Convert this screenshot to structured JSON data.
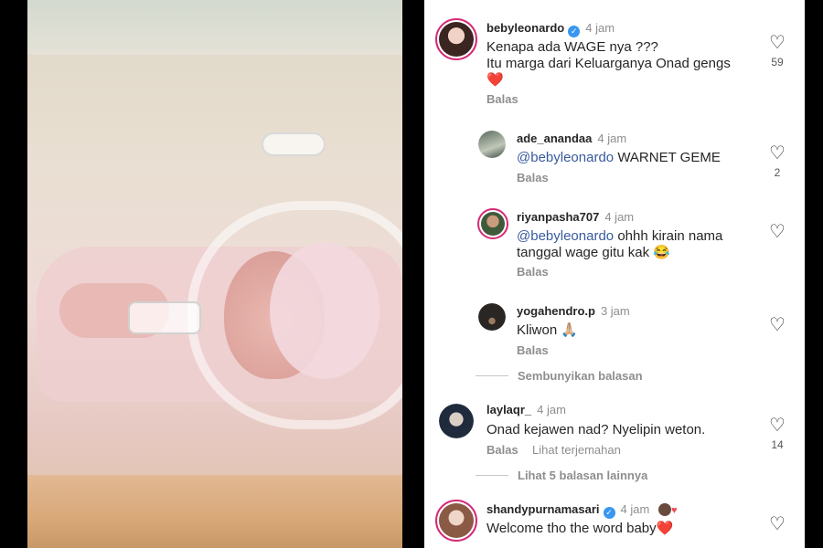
{
  "comments": [
    {
      "username": "bebyleonardo",
      "verified": true,
      "time": "4 jam",
      "text_line1": "Kenapa ada WAGE nya ???",
      "text_line2": "Itu marga dari Keluarganya Onad gengs",
      "emoji": "❤️",
      "reply_label": "Balas",
      "likes": "59"
    }
  ],
  "replies": [
    {
      "username": "ade_anandaa",
      "time": "4 jam",
      "mention": "@bebyleonardo",
      "text": "WARNET GEME",
      "reply_label": "Balas",
      "likes": "2"
    },
    {
      "username": "riyanpasha707",
      "time": "4 jam",
      "mention": "@bebyleonardo",
      "text": "ohhh kirain nama",
      "text_line2": "tanggal wage gitu kak 😂",
      "reply_label": "Balas"
    },
    {
      "username": "yogahendro.p",
      "time": "3 jam",
      "text": "Kliwon 🙏🏼",
      "reply_label": "Balas"
    }
  ],
  "hide_replies": "Sembunyikan balasan",
  "second_comment": {
    "username": "laylaqr_",
    "time": "4 jam",
    "text": "Onad kejawen nad? Nyelipin weton.",
    "reply_label": "Balas",
    "translate_label": "Lihat terjemahan",
    "likes": "14",
    "more_replies": "Lihat 5 balasan lainnya"
  },
  "third_comment": {
    "username": "shandypurnamasari",
    "verified": true,
    "time": "4 jam",
    "text": "Welcome tho the word baby❤️"
  },
  "icons": {
    "like": "heart-outline-icon",
    "verified": "verified-badge-icon"
  },
  "colors": {
    "mention": "#375a9e",
    "verified": "#3897f0",
    "story_ring": "#d62976",
    "heart_red": "#ed4956"
  }
}
